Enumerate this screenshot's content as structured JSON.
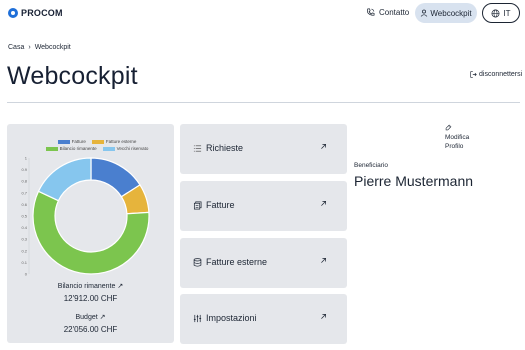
{
  "header": {
    "logo_text": "PROCOM",
    "contact_label": "Contatto",
    "cockpit_label": "Webcockpit",
    "lang_label": "IT"
  },
  "breadcrumb": {
    "home": "Casa",
    "separator": "›",
    "current": "Webcockpit"
  },
  "page": {
    "title": "Webcockpit",
    "logout_label": "disconnettersi"
  },
  "summary": {
    "remaining_label": "Bilancio rimanente",
    "remaining_value": "12'912.00 CHF",
    "budget_label": "Budget",
    "budget_value": "22'056.00 CHF"
  },
  "actions": [
    {
      "label": "Richieste",
      "icon": "list-icon"
    },
    {
      "label": "Fatture",
      "icon": "invoice-icon"
    },
    {
      "label": "Fatture esterne",
      "icon": "database-icon"
    },
    {
      "label": "Impostazioni",
      "icon": "sliders-icon"
    }
  ],
  "profile": {
    "edit_label_line1": "Modifica",
    "edit_label_line2": "Profilo",
    "beneficiary_label": "Beneficiario",
    "beneficiary_name": "Pierre Mustermann"
  },
  "colors": {
    "fatture": "#4a7fcf",
    "fatture_esterne": "#e6b43c",
    "bilancio_rimanente": "#7cc54e",
    "vecchi_riservato": "#86c6ee",
    "accent_pill": "#d8e2ef"
  },
  "chart_data": {
    "type": "pie",
    "donut": true,
    "categories": [
      "Fatture",
      "Fatture esterne",
      "Bilancio rimanente",
      "Vecchi riservato"
    ],
    "values": [
      0.16,
      0.08,
      0.58,
      0.18
    ],
    "legend_position": "top",
    "yticks": [
      "0",
      "0.1",
      "0.2",
      "0.3",
      "0.4",
      "0.5",
      "0.6",
      "0.7",
      "0.8",
      "0.9",
      "1"
    ],
    "ylim": [
      0,
      1
    ]
  }
}
